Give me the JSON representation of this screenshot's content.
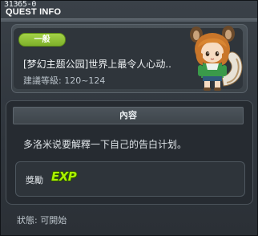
{
  "window": {
    "id_label": "31365-0",
    "title": "QUEST INFO"
  },
  "header": {
    "tag": "一般",
    "quest_name": "[梦幻主题公园]世界上最令人心动..",
    "level": "建議等級: 120~124",
    "npc_icon": "squirrel-girl-npc-portrait"
  },
  "content": {
    "title": "內容",
    "text": "多洛米说要解釋一下自己的告白计划。",
    "reward_label": "獎勵",
    "reward_exp": "EXP"
  },
  "status": "狀態: 可開始",
  "colors": {
    "tag_green": "#8fc03a",
    "exp_green": "#aaf200",
    "background": "#2f353c"
  }
}
